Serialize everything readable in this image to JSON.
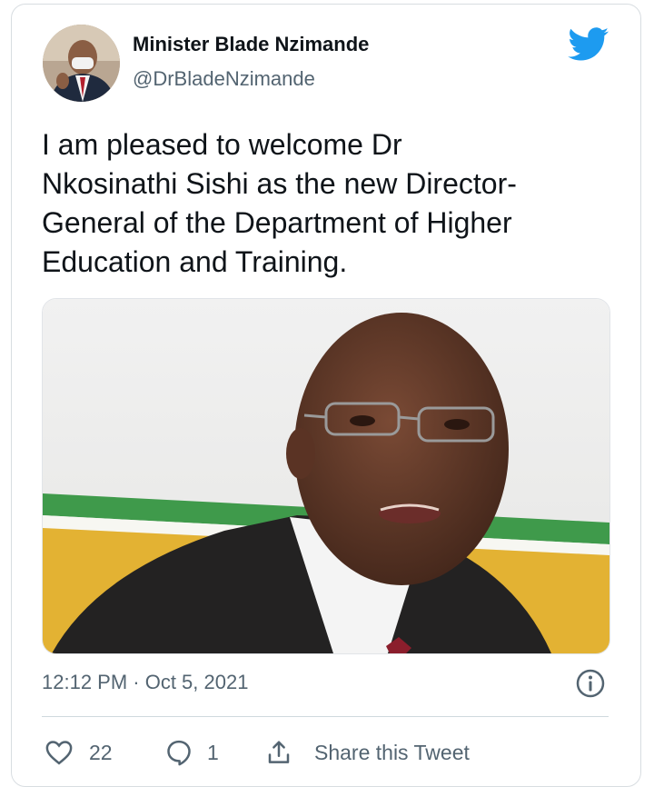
{
  "tweet": {
    "author": {
      "display_name": "Minister Blade Nzimande",
      "handle": "@DrBladeNzimande",
      "avatar_icon": "profile-photo"
    },
    "platform_icon": "twitter-bird-icon",
    "brand_color": "#1d9bf0",
    "text_lines": [
      "I am pleased to welcome Dr",
      "Nkosinathi Sishi as the new Director-",
      "General of the Department of Higher",
      "Education and Training."
    ],
    "media": {
      "type": "photo"
    },
    "timestamp": "12:12 PM · Oct 5, 2021",
    "actions": {
      "like_count": "22",
      "reply_count": "1",
      "share_label": "Share this Tweet"
    }
  }
}
